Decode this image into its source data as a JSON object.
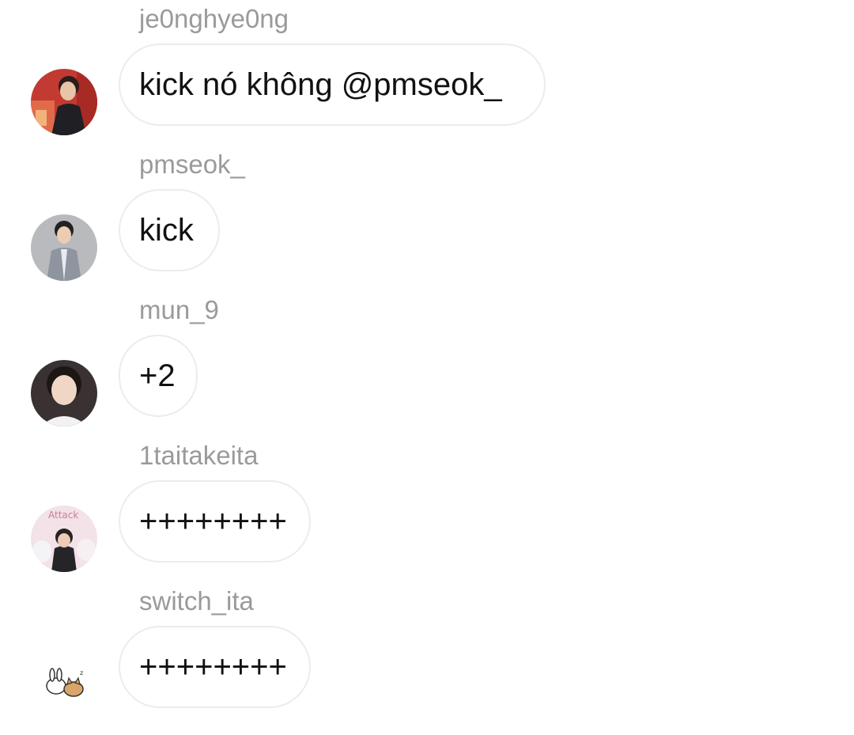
{
  "messages": [
    {
      "username": "je0nghye0ng",
      "text": "kick nó không @pmseok_",
      "avatar": "avatar-photo-red-backdrop"
    },
    {
      "username": "pmseok_",
      "text": "kick",
      "avatar": "avatar-photo-suit"
    },
    {
      "username": "mun_9",
      "text": "+2",
      "avatar": "avatar-photo-portrait"
    },
    {
      "username": "1taitakeita",
      "text": "++++++++",
      "avatar": "avatar-photo-plushies"
    },
    {
      "username": "switch_ita",
      "text": "++++++++",
      "avatar": "avatar-sticker-bunny-cat"
    }
  ],
  "avatar_texts": {
    "plushies_sign": "Attack"
  }
}
